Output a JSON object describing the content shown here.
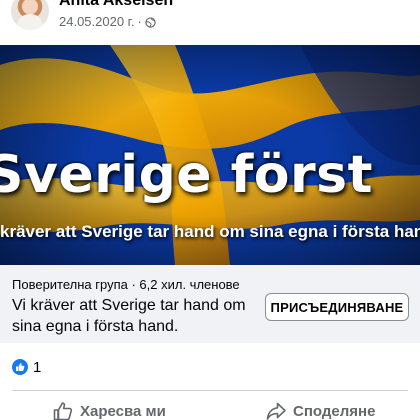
{
  "post": {
    "author": "Anita Akselsen",
    "date": "24.05.2020 г.",
    "separator": "·",
    "privacy_icon": "globe-icon"
  },
  "banner": {
    "title": "Sverige först",
    "subtitle": "kräver att Sverige tar hand om sina egna i första hand",
    "colors": {
      "blue": "#0a3aa8",
      "yellow": "#f7b500"
    }
  },
  "group": {
    "meta": "Поверителна група · 6,2 хил. членове",
    "name": "Vi kräver att Sverige tar hand om sina egna i första hand.",
    "join_label": "ПРИСЪЕДИНЯВАНЕ"
  },
  "reactions": {
    "icon": "like-icon",
    "count": "1"
  },
  "actions": {
    "like_label": "Харесва ми",
    "share_label": "Споделяне"
  },
  "colors": {
    "accent": "#1877f2",
    "secondary_text": "#65676b",
    "card_background": "#f0f2f5"
  }
}
